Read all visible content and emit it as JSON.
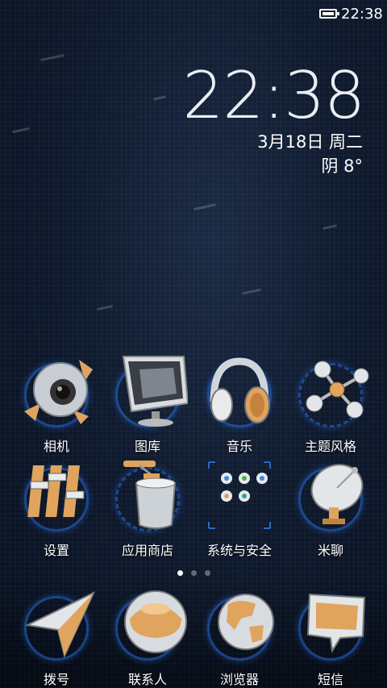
{
  "status": {
    "time": "22:38"
  },
  "clock": {
    "time": "22:38",
    "date": "3月18日 周二",
    "weather": "阴  8°"
  },
  "apps": [
    {
      "label": "相机",
      "icon": "camera-icon"
    },
    {
      "label": "图库",
      "icon": "gallery-icon"
    },
    {
      "label": "音乐",
      "icon": "music-icon"
    },
    {
      "label": "主题风格",
      "icon": "theme-icon"
    },
    {
      "label": "设置",
      "icon": "settings-icon"
    },
    {
      "label": "应用商店",
      "icon": "app-store-icon"
    },
    {
      "label": "系统与安全",
      "icon": "system-security-folder-icon"
    },
    {
      "label": "米聊",
      "icon": "miliao-icon"
    }
  ],
  "dock": [
    {
      "label": "拨号",
      "icon": "dialer-icon"
    },
    {
      "label": "联系人",
      "icon": "contacts-icon"
    },
    {
      "label": "浏览器",
      "icon": "browser-icon"
    },
    {
      "label": "短信",
      "icon": "messages-icon"
    }
  ],
  "pager": {
    "pages": 3,
    "current": 1
  },
  "colors": {
    "accent": "#e0a45f",
    "ring": "#286edc",
    "background": "#0f1a2e"
  }
}
